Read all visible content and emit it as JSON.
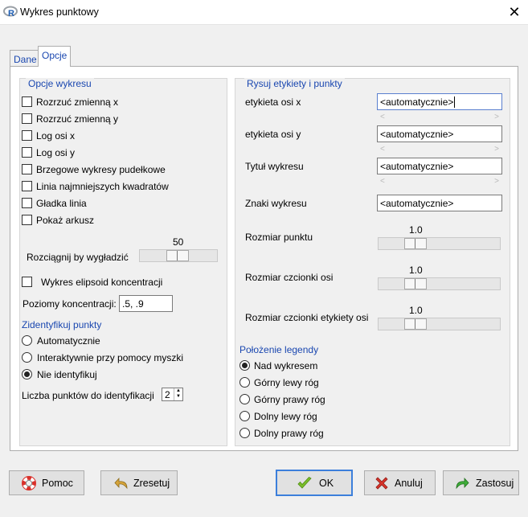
{
  "window": {
    "title": "Wykres punktowy",
    "close_glyph": "✕",
    "app_icon": "r-logo-icon"
  },
  "tabs": [
    {
      "label": "Dane",
      "active": false
    },
    {
      "label": "Opcje",
      "active": true
    }
  ],
  "left": {
    "group_title": "Opcje wykresu",
    "checkboxes": [
      {
        "label": "Rozrzuć zmienną x",
        "checked": false
      },
      {
        "label": "Rozrzuć zmienną y",
        "checked": false
      },
      {
        "label": "Log osi x",
        "checked": false
      },
      {
        "label": "Log osi y",
        "checked": false
      },
      {
        "label": "Brzegowe wykresy pudełkowe",
        "checked": false
      },
      {
        "label": "Linia najmniejszych kwadratów",
        "checked": false
      },
      {
        "label": "Gładka linia",
        "checked": false
      },
      {
        "label": "Pokaż arkusz",
        "checked": false
      }
    ],
    "smooth": {
      "label": "Rozciągnij by wygładzić",
      "value": "50"
    },
    "ellipse": {
      "label": "Wykres elipsoid koncentracji",
      "checked": false
    },
    "levels": {
      "label": "Poziomy koncentracji:",
      "value": ".5, .9"
    },
    "identify": {
      "title": "Zidentyfikuj punkty",
      "options": [
        {
          "label": "Automatycznie",
          "selected": false
        },
        {
          "label": "Interaktywnie przy pomocy myszki",
          "selected": false
        },
        {
          "label": "Nie identyfikuj",
          "selected": true
        }
      ]
    },
    "count": {
      "label": "Liczba punktów do identyfikacji",
      "value": "2"
    }
  },
  "right": {
    "group_title": "Rysuj etykiety i punkty",
    "fields": [
      {
        "label": "etykieta osi x",
        "value": "<automatycznie>"
      },
      {
        "label": "etykieta osi y",
        "value": "<automatycznie>"
      },
      {
        "label": "Tytuł wykresu",
        "value": "<automatycznie>"
      },
      {
        "label": "Znaki wykresu",
        "value": "<automatycznie>"
      }
    ],
    "scroll_left": "<",
    "scroll_right": ">",
    "sliders": [
      {
        "label": "Rozmiar punktu",
        "value": "1.0",
        "fraction": 0.5
      },
      {
        "label": "Rozmiar czcionki osi",
        "value": "1.0",
        "fraction": 0.5
      },
      {
        "label": "Rozmiar czcionki etykiety osi",
        "value": "1.0",
        "fraction": 0.5
      }
    ],
    "legend": {
      "title": "Położenie legendy",
      "options": [
        {
          "label": "Nad wykresem",
          "selected": true
        },
        {
          "label": "Górny lewy róg",
          "selected": false
        },
        {
          "label": "Górny prawy róg",
          "selected": false
        },
        {
          "label": "Dolny lewy róg",
          "selected": false
        },
        {
          "label": "Dolny prawy róg",
          "selected": false
        }
      ]
    }
  },
  "buttons": {
    "help": {
      "label": "Pomoc",
      "icon": "lifebuoy-icon"
    },
    "reset": {
      "label": "Zresetuj",
      "icon": "undo-arrow-icon"
    },
    "ok": {
      "label": "OK",
      "icon": "checkmark-icon"
    },
    "cancel": {
      "label": "Anuluj",
      "icon": "red-x-icon"
    },
    "apply": {
      "label": "Zastosuj",
      "icon": "redo-arrow-icon"
    }
  },
  "colors": {
    "accent": "#1a47b0",
    "focus_border": "#3c7fdb"
  }
}
